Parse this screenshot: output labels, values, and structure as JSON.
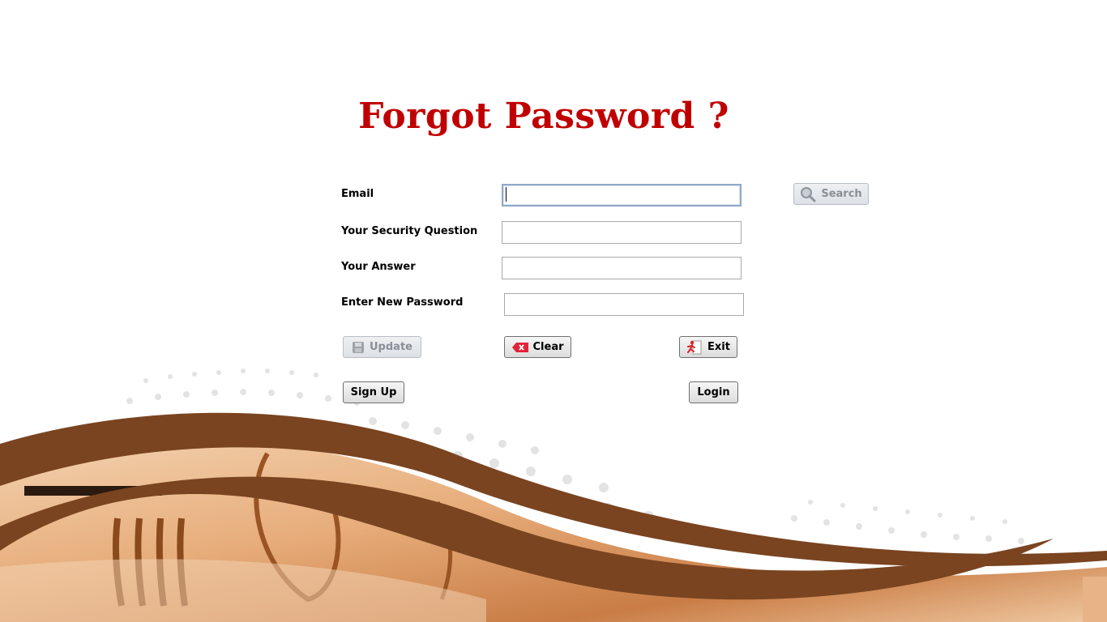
{
  "title": "Forgot Password ?",
  "form": {
    "email": {
      "label": "Email",
      "value": ""
    },
    "security_question": {
      "label": "Your Security Question",
      "value": ""
    },
    "answer": {
      "label": "Your Answer",
      "value": ""
    },
    "new_password": {
      "label": "Enter New Password",
      "value": ""
    }
  },
  "buttons": {
    "search": "Search",
    "update": "Update",
    "clear": "Clear",
    "exit": "Exit",
    "signup": "Sign Up",
    "login": "Login"
  },
  "colors": {
    "title": "#c00000",
    "wave_dark": "#7a4420",
    "wave_light": "#e9b98e"
  },
  "icons": {
    "search": "magnifier-icon",
    "update": "floppy-disk-icon",
    "clear": "eraser-x-icon",
    "exit": "exit-door-icon"
  }
}
